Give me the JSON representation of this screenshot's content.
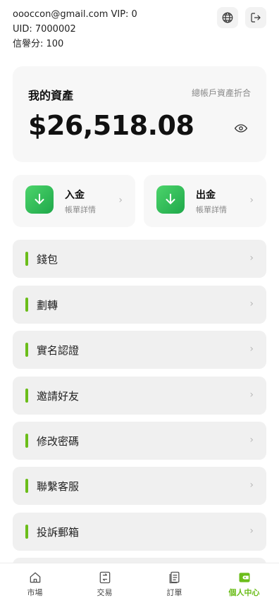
{
  "user": {
    "email_vip": "oooccon@gmail.com VIP: 0",
    "uid": "UID: 7000002",
    "credit": "信譽分: 100"
  },
  "assets": {
    "title": "我的資產",
    "subtitle": "總帳戶資產折合",
    "value": "$26,518.08"
  },
  "quick": {
    "deposit": {
      "title": "入金",
      "sub": "帳單詳情"
    },
    "withdraw": {
      "title": "出金",
      "sub": "帳單詳情"
    }
  },
  "menu": {
    "items": [
      {
        "label": "錢包"
      },
      {
        "label": "劃轉"
      },
      {
        "label": "實名認證"
      },
      {
        "label": "邀請好友"
      },
      {
        "label": "修改密碼"
      },
      {
        "label": "聯繫客服"
      },
      {
        "label": "投訴郵箱"
      }
    ]
  },
  "tabs": [
    {
      "label": "市場",
      "icon": "home-icon"
    },
    {
      "label": "交易",
      "icon": "swap-icon"
    },
    {
      "label": "訂單",
      "icon": "document-icon"
    },
    {
      "label": "個人中心",
      "icon": "wallet-icon"
    }
  ],
  "colors": {
    "accent": "#6bbd1a",
    "green_icon": "#2bb552"
  }
}
